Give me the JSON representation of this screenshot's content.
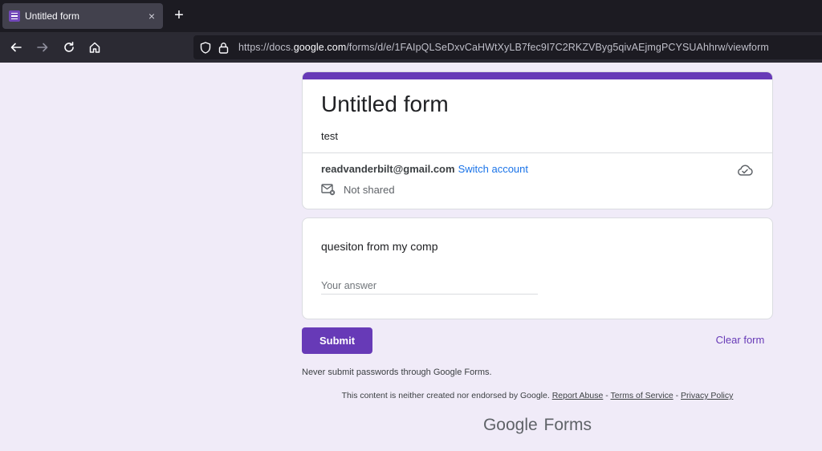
{
  "browser": {
    "tab_title": "Untitled form",
    "tab_close": "×",
    "new_tab": "+",
    "url_prefix": "https://docs.",
    "url_host": "google.com",
    "url_path": "/forms/d/e/1FAIpQLSeDxvCaHWtXyLB7fec9I7C2RKZVByg5qivAEjmgPCYSUAhhrw/viewform"
  },
  "form": {
    "title": "Untitled form",
    "description": "test",
    "account_email": "readvanderbilt@gmail.com",
    "switch_account": "Switch account",
    "not_shared": "Not shared",
    "accent_color": "#673ab7"
  },
  "question": {
    "label": "quesiton from my comp",
    "placeholder": "Your answer",
    "value": ""
  },
  "actions": {
    "submit": "Submit",
    "clear": "Clear form"
  },
  "footer": {
    "password_note": "Never submit passwords through Google Forms.",
    "disclaimer": "This content is neither created nor endorsed by Google.",
    "report_abuse": "Report Abuse",
    "sep1": " - ",
    "terms": "Terms of Service",
    "sep2": " - ",
    "privacy": "Privacy Policy",
    "brand_google": "Google",
    "brand_forms": "Forms"
  }
}
